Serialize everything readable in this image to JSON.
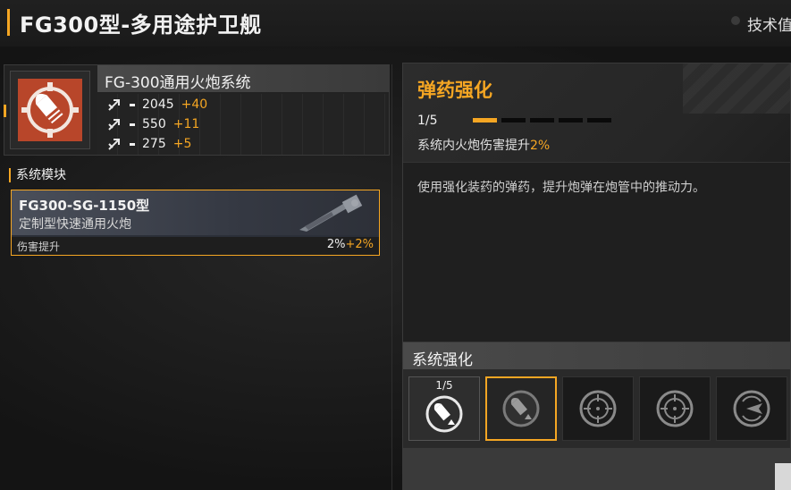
{
  "header": {
    "title": "FG300型-多用途护卫舰",
    "tech_label": "技术值"
  },
  "weapon": {
    "name": "FG-300通用火炮系统",
    "icon": "shell-icon",
    "stats": [
      {
        "icon": "attack-arrow-icon",
        "value": "2045",
        "bonus": "+40"
      },
      {
        "icon": "attack-arrow-icon",
        "value": "550",
        "bonus": "+11"
      },
      {
        "icon": "attack-arrow-icon",
        "value": "275",
        "bonus": "+5"
      }
    ]
  },
  "modules": {
    "label": "系统模块",
    "card": {
      "name": "FG300-SG-1150型",
      "subtitle": "定制型快速通用火炮",
      "stat_label": "伤害提升",
      "stat_value": "2%",
      "stat_bonus": "+2%"
    }
  },
  "detail": {
    "title": "弹药强化",
    "level": "1/5",
    "level_current": 1,
    "level_max": 5,
    "effect_prefix": "系统内火炮伤害提升",
    "effect_value": "2%",
    "description": "使用强化装药的弹药，提升炮弹在炮管中的推动力。"
  },
  "system": {
    "title": "系统强化",
    "slots": [
      {
        "level": "1/5",
        "icon": "shell-upgrade-icon",
        "state": "active"
      },
      {
        "level": "",
        "icon": "shell-upgrade-icon",
        "state": "selected"
      },
      {
        "level": "",
        "icon": "crosshair-icon",
        "state": "locked"
      },
      {
        "level": "",
        "icon": "crosshair-icon",
        "state": "locked"
      },
      {
        "level": "",
        "icon": "radar-icon",
        "state": "locked"
      }
    ]
  },
  "colors": {
    "accent": "#f5a623",
    "weapon_icon_bg": "#b8462a"
  }
}
